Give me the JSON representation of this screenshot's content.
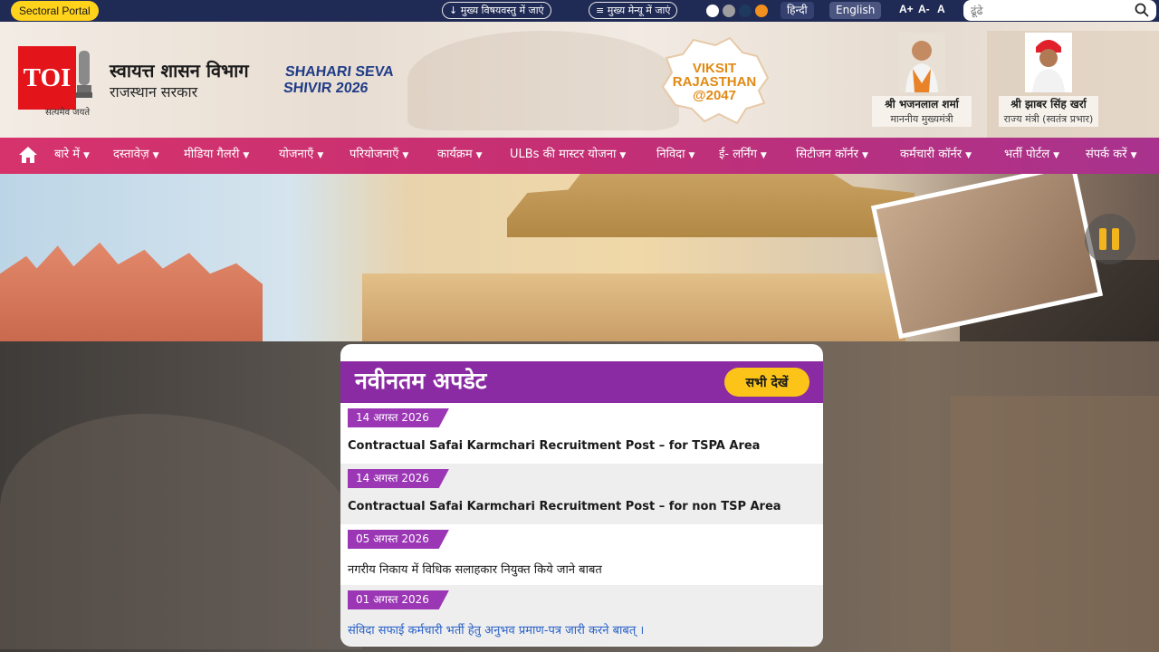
{
  "topbar": {
    "sectoral_portal": "Sectoral Portal",
    "skip_content": "↓ मुख्य विषयवस्तु में जाएं",
    "skip_menu": "≡ मुख्य मेन्यू में जाएं",
    "theme_colors": [
      "#ffffff",
      "#9e9e9e",
      "#1d3a5c",
      "#f0901e"
    ],
    "lang_hindi": "हिन्दी",
    "lang_english": "English",
    "font_increase": "A+",
    "font_decrease": "A-",
    "font_reset": "A",
    "search_placeholder": "ढूंढे",
    "search_icon": "search-icon"
  },
  "header": {
    "logo_text": "TOI",
    "emblem_motto": "सत्यमेव जयते",
    "department": "स्वायत्त शासन विभाग",
    "government": "राजस्थान सरकार",
    "shivir_line1": "SHAHARI SEVA",
    "shivir_line2": "SHIVIR 2026",
    "viksit_line1": "VIKSIT",
    "viksit_line2": "RAJASTHAN",
    "viksit_line3": "@2047",
    "persons": [
      {
        "name": "श्री भजनलाल शर्मा",
        "title": "माननीय मुख्यमंत्री"
      },
      {
        "name": "श्री झाबर सिंह खर्रा",
        "title": "राज्य मंत्री (स्वतंत्र प्रभार)"
      }
    ]
  },
  "nav": {
    "home_icon": "home-icon",
    "items": [
      {
        "label": "बारे में"
      },
      {
        "label": "दस्तावेज़"
      },
      {
        "label": "मीडिया गैलरी"
      },
      {
        "label": "योजनाएँ"
      },
      {
        "label": "परियोजनाएँ"
      },
      {
        "label": "कार्यक्रम"
      },
      {
        "label": "ULBs की मास्टर योजना"
      },
      {
        "label": "निविदा"
      },
      {
        "label": "ई- लर्निंग"
      },
      {
        "label": "सिटीजन कॉर्नर"
      },
      {
        "label": "कर्मचारी कॉर्नर"
      },
      {
        "label": "भर्ती पोर्टल"
      },
      {
        "label": "संपर्क करें"
      }
    ]
  },
  "banner": {
    "pause_icon": "pause-icon"
  },
  "updates": {
    "title": "नवीनतम अपडेट",
    "view_all": "सभी देखें",
    "items": [
      {
        "date": "14 अगस्त 2026",
        "text": "Contractual Safai Karmchari Recruitment Post – for TSPA Area"
      },
      {
        "date": "14 अगस्त 2026",
        "text": "Contractual Safai Karmchari Recruitment Post – for non TSP Area"
      },
      {
        "date": "05 अगस्त 2026",
        "text": "नगरीय निकाय में विधिक सलाहकार नियुक्त किये जाने बाबत"
      },
      {
        "date": "01 अगस्त 2026",
        "text": "संविदा सफाई कर्मचारी भर्ती हेतु अनुभव प्रमाण-पत्र जारी करने बाबत् ।"
      }
    ]
  },
  "colors": {
    "topbar": "#1f2a55",
    "accent_yellow": "#fcc419",
    "nav_pink": "#d6336c",
    "nav_purple": "#a8328e",
    "updates_purple": "#8a2ba3",
    "link_blue": "#2a62c9"
  }
}
